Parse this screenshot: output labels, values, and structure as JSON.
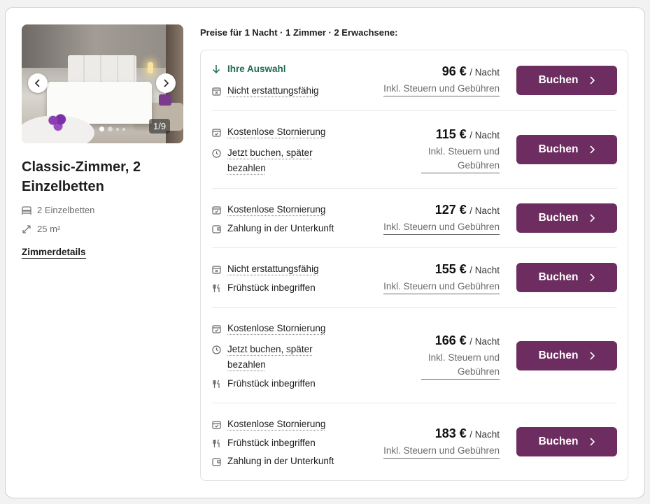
{
  "room": {
    "title": "Classic-Zimmer, 2 Einzelbetten",
    "beds": "2 Einzelbetten",
    "size": "25 m²",
    "details_link": "Zimmerdetails",
    "photo_counter": "1/9"
  },
  "prices_header": "Preise für 1 Nacht · 1 Zimmer · 2 Erwachsene:",
  "per_night": "/ Nacht",
  "tax_note": "Inkl. Steuern und Gebühren",
  "book_label": "Buchen",
  "colors": {
    "accent": "#6e2d60",
    "selected": "#1f6b55"
  },
  "offers": [
    {
      "perks": [
        {
          "text": "Ihre Auswahl",
          "icon": "arrow-down-icon"
        },
        {
          "text": "Nicht erstattungsfähig",
          "icon": "calendar-x-icon"
        }
      ],
      "price": "96 €"
    },
    {
      "perks": [
        {
          "text": "Kostenlose Stornierung",
          "icon": "calendar-check-icon"
        },
        {
          "text": "Jetzt buchen, später bezahlen",
          "icon": "clock-icon"
        }
      ],
      "price": "115 €"
    },
    {
      "perks": [
        {
          "text": "Kostenlose Stornierung",
          "icon": "calendar-check-icon"
        },
        {
          "text": "Zahlung in der Unterkunft",
          "icon": "wallet-icon"
        }
      ],
      "price": "127 €"
    },
    {
      "perks": [
        {
          "text": "Nicht erstattungsfähig",
          "icon": "calendar-x-icon"
        },
        {
          "text": "Frühstück inbegriffen",
          "icon": "utensils-icon"
        }
      ],
      "price": "155 €"
    },
    {
      "perks": [
        {
          "text": "Kostenlose Stornierung",
          "icon": "calendar-check-icon"
        },
        {
          "text": "Jetzt buchen, später bezahlen",
          "icon": "clock-icon"
        },
        {
          "text": "Frühstück inbegriffen",
          "icon": "utensils-icon"
        }
      ],
      "price": "166 €"
    },
    {
      "perks": [
        {
          "text": "Kostenlose Stornierung",
          "icon": "calendar-check-icon"
        },
        {
          "text": "Frühstück inbegriffen",
          "icon": "utensils-icon"
        },
        {
          "text": "Zahlung in der Unterkunft",
          "icon": "wallet-icon"
        }
      ],
      "price": "183 €"
    }
  ]
}
